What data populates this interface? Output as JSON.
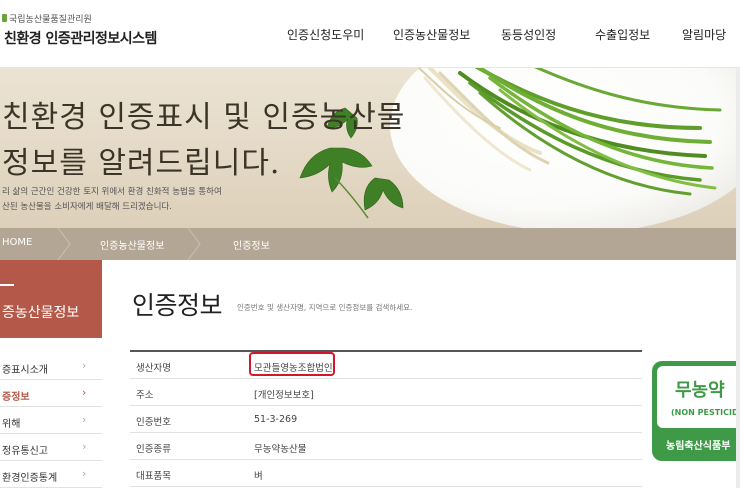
{
  "header": {
    "org": "국립농산물품질관리원",
    "system_title": "친환경 인증관리정보시스템",
    "nav": [
      "인증신청도우미",
      "인증농산물정보",
      "동등성인정",
      "수출입정보",
      "알림마당"
    ]
  },
  "hero": {
    "title_line1": "친환경 인증표시 및 인증농산물",
    "title_line2": "정보를 알려드립니다.",
    "desc_line1": "리 삶의 근간인 건강한 토지 위에서 환경 친화적 농법을 통하여",
    "desc_line2": "산된 농산물을 소비자에게 배달해 드리겠습니다."
  },
  "breadcrumb": [
    "HOME",
    "인증농산물정보",
    "인증정보"
  ],
  "sidebar": {
    "title": "증농산물정보",
    "items": [
      {
        "label": "증표시소개",
        "active": false
      },
      {
        "label": "증정보",
        "active": true
      },
      {
        "label": "위해",
        "active": false
      },
      {
        "label": "정유통신고",
        "active": false
      },
      {
        "label": "환경인증통계",
        "active": false
      }
    ]
  },
  "main": {
    "title": "인증정보",
    "description": "인증번호 및 생산자명, 지역으로 인증정보를 검색하세요.",
    "rows": [
      {
        "label": "생산자명",
        "value": "모관들영농조합법인"
      },
      {
        "label": "주소",
        "value": "[개인정보보호]"
      },
      {
        "label": "인증번호",
        "value": "51-3-269"
      },
      {
        "label": "인증종류",
        "value": "무농약농산물"
      },
      {
        "label": "대표품목",
        "value": "벼"
      }
    ]
  },
  "cert_mark": {
    "main": "무농약",
    "sub": "(NON PESTICIDE)",
    "footer": "농림축산식품부"
  },
  "colors": {
    "sidebar_accent": "#b4594a",
    "breadcrumb_bg": "#b4a694",
    "cert_green": "#3f9a47",
    "highlight_red": "#d0182a"
  }
}
